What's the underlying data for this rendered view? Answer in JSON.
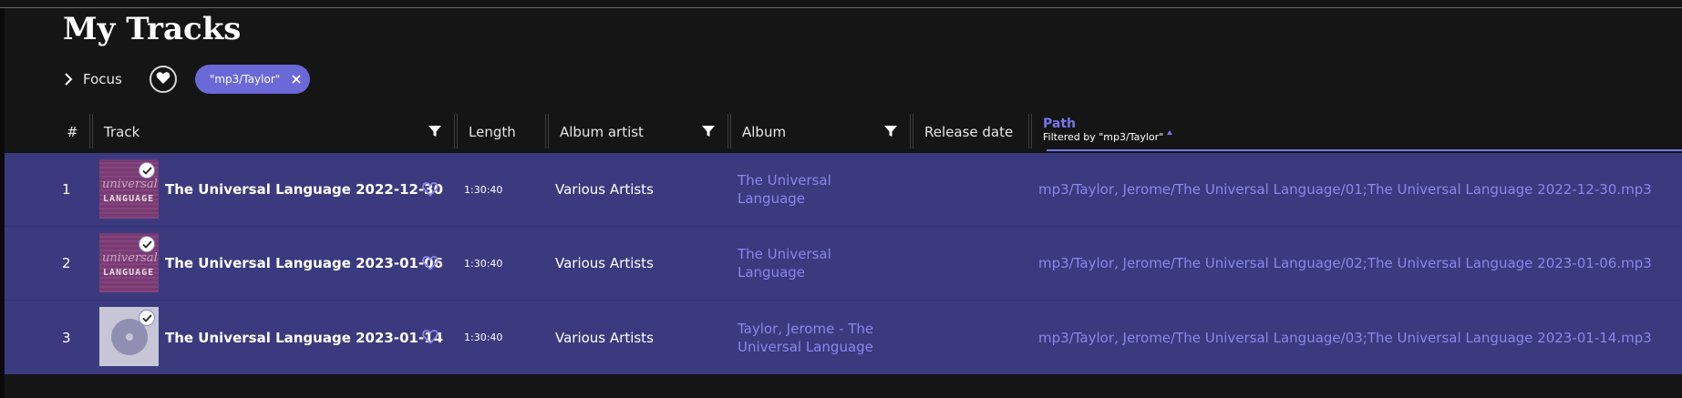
{
  "page": {
    "title": "My Tracks"
  },
  "toolbar": {
    "focus_label": "Focus",
    "filter_chip": "\"mp3/Taylor\""
  },
  "columns": {
    "num": "#",
    "track": "Track",
    "length": "Length",
    "album_artist": "Album artist",
    "album": "Album",
    "release_date": "Release date",
    "path": "Path",
    "path_filter_note": "Filtered by \"mp3/Taylor\""
  },
  "tracks": [
    {
      "num": "1",
      "title": "The Universal Language 2022-12-30",
      "length": "1:30:40",
      "album_artist": "Various Artists",
      "album": "The Universal Language",
      "release_date": "",
      "path": "mp3/Taylor, Jerome/The Universal Language/01;The Universal Language 2022-12-30.mp3",
      "art": "universal-language-cover",
      "art_text_1": "universal",
      "art_text_2": "LANGUAGE"
    },
    {
      "num": "2",
      "title": "The Universal Language 2023-01-06",
      "length": "1:30:40",
      "album_artist": "Various Artists",
      "album": "The Universal Language",
      "release_date": "",
      "path": "mp3/Taylor, Jerome/The Universal Language/02;The Universal Language 2023-01-06.mp3",
      "art": "universal-language-cover",
      "art_text_1": "universal",
      "art_text_2": "LANGUAGE"
    },
    {
      "num": "3",
      "title": "The Universal Language 2023-01-14",
      "length": "1:30:40",
      "album_artist": "Various Artists",
      "album": "Taylor, Jerome - The Universal Language",
      "release_date": "",
      "path": "mp3/Taylor, Jerome/The Universal Language/03;The Universal Language 2023-01-14.mp3",
      "art": "generic-disc-cover"
    }
  ],
  "icons": {
    "focus": "chevron-right-icon",
    "favorites_filter": "heart-icon",
    "chip_close": "close-icon",
    "column_filter": "filter-icon",
    "sort": "sort-asc-icon",
    "row_favorite": "heart-outline-icon",
    "selected": "check-icon"
  },
  "colors": {
    "background": "#151515",
    "accent": "#6b68d8",
    "row_selected": "#3b3a7f",
    "link": "#8987ea"
  }
}
